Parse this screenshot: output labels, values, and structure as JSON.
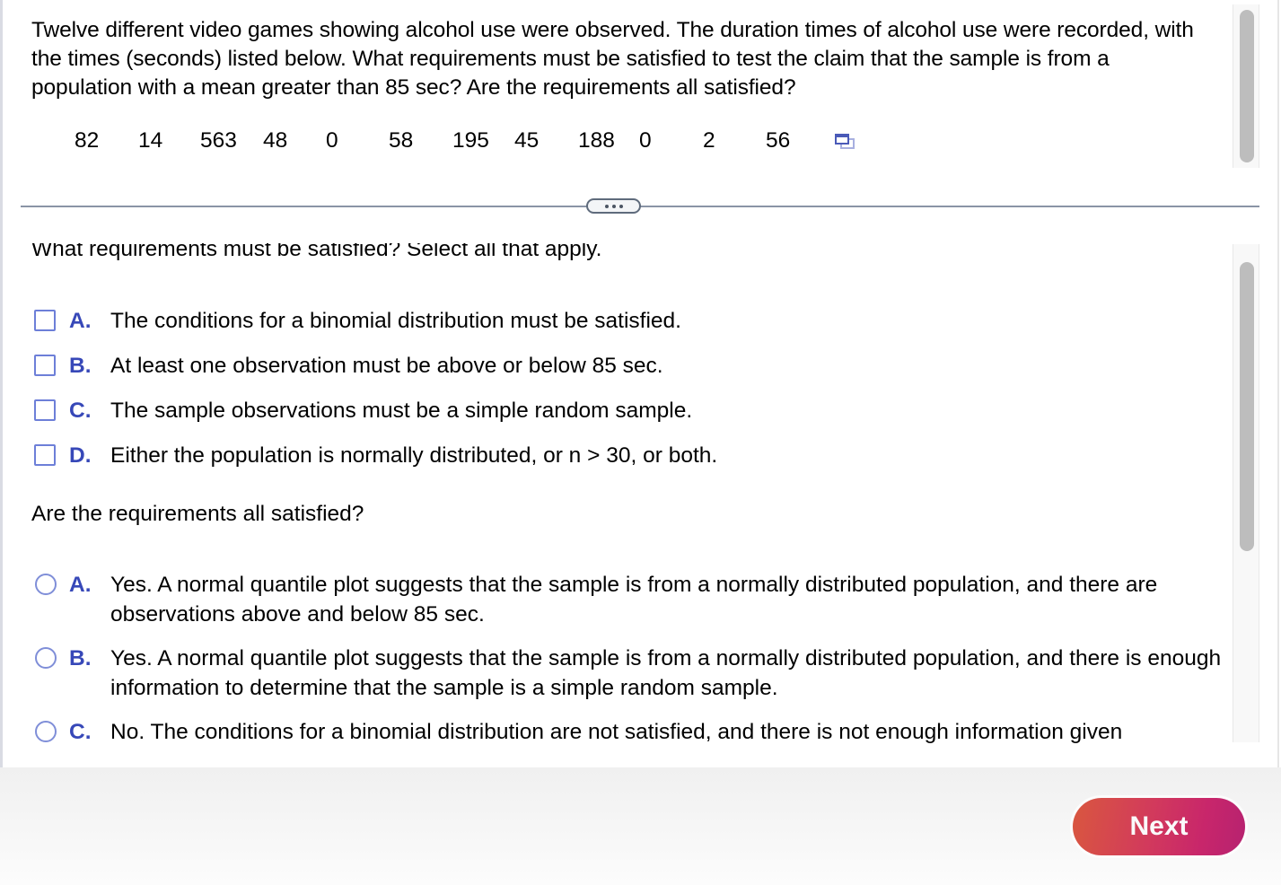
{
  "question": {
    "text": "Twelve different video games showing alcohol use were observed. The duration times of alcohol use were recorded, with the times (seconds) listed below. What requirements must be satisfied to test the claim that the sample is from a population with a mean greater than 85 sec? Are the requirements all satisfied?",
    "data_values": [
      "82",
      "14",
      "563",
      "48",
      "0",
      "58",
      "195",
      "45",
      "188",
      "0",
      "2",
      "56"
    ],
    "popout_icon": "popout-window-icon"
  },
  "divider": {
    "handle_icon": "more-horizontal-icon"
  },
  "part1": {
    "prompt": "What requirements must be satisfied? Select all that apply.",
    "options": [
      {
        "letter": "A.",
        "text": "The conditions for a binomial distribution must be satisfied.",
        "checked": false
      },
      {
        "letter": "B.",
        "text": "At least one observation must be above or below 85 sec.",
        "checked": false
      },
      {
        "letter": "C.",
        "text": "The sample observations must be a simple random sample.",
        "checked": false
      },
      {
        "letter": "D.",
        "text": "Either the population is normally distributed, or n > 30, or both.",
        "checked": false
      }
    ]
  },
  "part2": {
    "prompt": "Are the requirements all satisfied?",
    "options": [
      {
        "letter": "A.",
        "text": "Yes. A normal quantile plot suggests that the sample is from a normally distributed population, and there are observations above and below 85 sec.",
        "selected": false
      },
      {
        "letter": "B.",
        "text": "Yes. A normal quantile plot suggests that the sample is from a normally distributed population, and there is enough information to determine that the sample is a simple random sample.",
        "selected": false
      },
      {
        "letter": "C.",
        "text": "No. The conditions for a binomial distribution are not satisfied, and there is not enough information given",
        "selected": false
      }
    ]
  },
  "footer": {
    "next_label": "Next"
  },
  "colors": {
    "option_letter": "#3748b8",
    "control_border": "#6d7fd8",
    "next_gradient_start": "#d9573f",
    "next_gradient_end": "#b62270",
    "divider": "#8a94a6"
  }
}
